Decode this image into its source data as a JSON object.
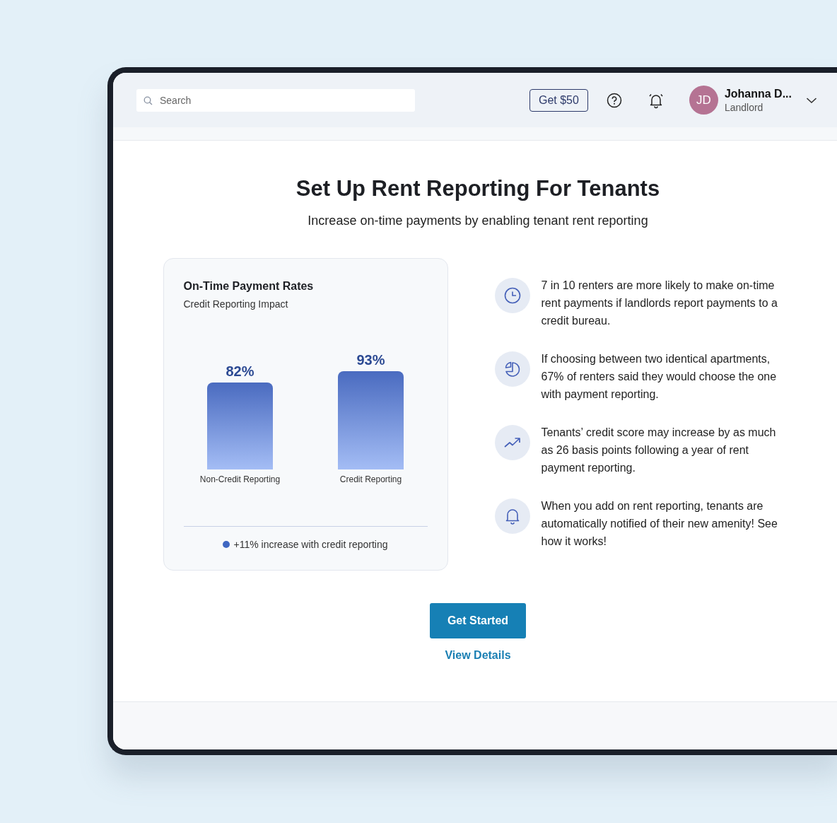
{
  "header": {
    "search": {
      "placeholder": "Search"
    },
    "promo_button": "Get $50",
    "user": {
      "initials": "JD",
      "name": "Johanna D...",
      "role": "Landlord"
    }
  },
  "main": {
    "title": "Set Up Rent Reporting For Tenants",
    "subtitle": "Increase on-time payments by enabling tenant rent reporting",
    "chart_card": {
      "title": "On-Time Payment Rates",
      "subtitle": "Credit Reporting Impact",
      "chart_data": {
        "type": "bar",
        "categories": [
          "Non-Credit Reporting",
          "Credit Reporting"
        ],
        "values": [
          82,
          93
        ],
        "data_labels": true,
        "value_labels": [
          "82%",
          "93%"
        ]
      },
      "legend": {
        "text": "+11% increase with credit reporting",
        "color": "#3f67c2"
      }
    },
    "facts": [
      {
        "kind": "clock",
        "text": "7 in 10 renters are more likely to make on-time rent payments if landlords report payments to a credit bureau."
      },
      {
        "kind": "pie",
        "text": "If choosing between two identical apartments, 67% of renters said they would choose the one with payment reporting."
      },
      {
        "kind": "trend",
        "text": "Tenants’ credit score may increase by as much as 26 basis points following a year of rent payment reporting."
      },
      {
        "kind": "bell",
        "text": "When you add on rent reporting, tenants are automatically notified of their new amenity! See how it works!"
      }
    ],
    "primary_button": "Get Started",
    "secondary_link": "View Details"
  }
}
